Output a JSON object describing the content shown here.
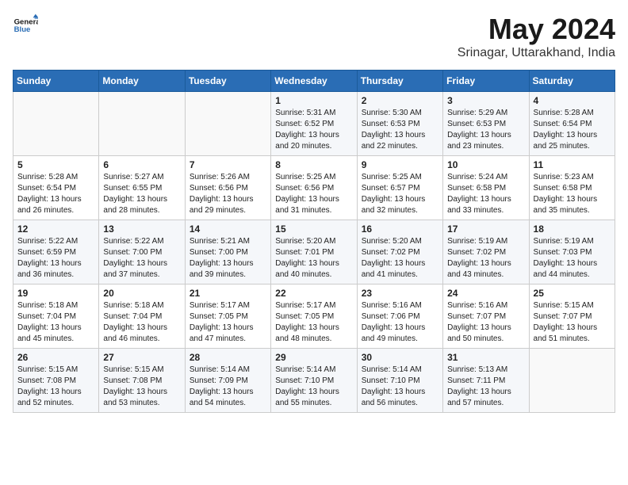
{
  "header": {
    "logo_general": "General",
    "logo_blue": "Blue",
    "month": "May 2024",
    "location": "Srinagar, Uttarakhand, India"
  },
  "weekdays": [
    "Sunday",
    "Monday",
    "Tuesday",
    "Wednesday",
    "Thursday",
    "Friday",
    "Saturday"
  ],
  "weeks": [
    [
      {
        "day": "",
        "info": ""
      },
      {
        "day": "",
        "info": ""
      },
      {
        "day": "",
        "info": ""
      },
      {
        "day": "1",
        "info": "Sunrise: 5:31 AM\nSunset: 6:52 PM\nDaylight: 13 hours\nand 20 minutes."
      },
      {
        "day": "2",
        "info": "Sunrise: 5:30 AM\nSunset: 6:53 PM\nDaylight: 13 hours\nand 22 minutes."
      },
      {
        "day": "3",
        "info": "Sunrise: 5:29 AM\nSunset: 6:53 PM\nDaylight: 13 hours\nand 23 minutes."
      },
      {
        "day": "4",
        "info": "Sunrise: 5:28 AM\nSunset: 6:54 PM\nDaylight: 13 hours\nand 25 minutes."
      }
    ],
    [
      {
        "day": "5",
        "info": "Sunrise: 5:28 AM\nSunset: 6:54 PM\nDaylight: 13 hours\nand 26 minutes."
      },
      {
        "day": "6",
        "info": "Sunrise: 5:27 AM\nSunset: 6:55 PM\nDaylight: 13 hours\nand 28 minutes."
      },
      {
        "day": "7",
        "info": "Sunrise: 5:26 AM\nSunset: 6:56 PM\nDaylight: 13 hours\nand 29 minutes."
      },
      {
        "day": "8",
        "info": "Sunrise: 5:25 AM\nSunset: 6:56 PM\nDaylight: 13 hours\nand 31 minutes."
      },
      {
        "day": "9",
        "info": "Sunrise: 5:25 AM\nSunset: 6:57 PM\nDaylight: 13 hours\nand 32 minutes."
      },
      {
        "day": "10",
        "info": "Sunrise: 5:24 AM\nSunset: 6:58 PM\nDaylight: 13 hours\nand 33 minutes."
      },
      {
        "day": "11",
        "info": "Sunrise: 5:23 AM\nSunset: 6:58 PM\nDaylight: 13 hours\nand 35 minutes."
      }
    ],
    [
      {
        "day": "12",
        "info": "Sunrise: 5:22 AM\nSunset: 6:59 PM\nDaylight: 13 hours\nand 36 minutes."
      },
      {
        "day": "13",
        "info": "Sunrise: 5:22 AM\nSunset: 7:00 PM\nDaylight: 13 hours\nand 37 minutes."
      },
      {
        "day": "14",
        "info": "Sunrise: 5:21 AM\nSunset: 7:00 PM\nDaylight: 13 hours\nand 39 minutes."
      },
      {
        "day": "15",
        "info": "Sunrise: 5:20 AM\nSunset: 7:01 PM\nDaylight: 13 hours\nand 40 minutes."
      },
      {
        "day": "16",
        "info": "Sunrise: 5:20 AM\nSunset: 7:02 PM\nDaylight: 13 hours\nand 41 minutes."
      },
      {
        "day": "17",
        "info": "Sunrise: 5:19 AM\nSunset: 7:02 PM\nDaylight: 13 hours\nand 43 minutes."
      },
      {
        "day": "18",
        "info": "Sunrise: 5:19 AM\nSunset: 7:03 PM\nDaylight: 13 hours\nand 44 minutes."
      }
    ],
    [
      {
        "day": "19",
        "info": "Sunrise: 5:18 AM\nSunset: 7:04 PM\nDaylight: 13 hours\nand 45 minutes."
      },
      {
        "day": "20",
        "info": "Sunrise: 5:18 AM\nSunset: 7:04 PM\nDaylight: 13 hours\nand 46 minutes."
      },
      {
        "day": "21",
        "info": "Sunrise: 5:17 AM\nSunset: 7:05 PM\nDaylight: 13 hours\nand 47 minutes."
      },
      {
        "day": "22",
        "info": "Sunrise: 5:17 AM\nSunset: 7:05 PM\nDaylight: 13 hours\nand 48 minutes."
      },
      {
        "day": "23",
        "info": "Sunrise: 5:16 AM\nSunset: 7:06 PM\nDaylight: 13 hours\nand 49 minutes."
      },
      {
        "day": "24",
        "info": "Sunrise: 5:16 AM\nSunset: 7:07 PM\nDaylight: 13 hours\nand 50 minutes."
      },
      {
        "day": "25",
        "info": "Sunrise: 5:15 AM\nSunset: 7:07 PM\nDaylight: 13 hours\nand 51 minutes."
      }
    ],
    [
      {
        "day": "26",
        "info": "Sunrise: 5:15 AM\nSunset: 7:08 PM\nDaylight: 13 hours\nand 52 minutes."
      },
      {
        "day": "27",
        "info": "Sunrise: 5:15 AM\nSunset: 7:08 PM\nDaylight: 13 hours\nand 53 minutes."
      },
      {
        "day": "28",
        "info": "Sunrise: 5:14 AM\nSunset: 7:09 PM\nDaylight: 13 hours\nand 54 minutes."
      },
      {
        "day": "29",
        "info": "Sunrise: 5:14 AM\nSunset: 7:10 PM\nDaylight: 13 hours\nand 55 minutes."
      },
      {
        "day": "30",
        "info": "Sunrise: 5:14 AM\nSunset: 7:10 PM\nDaylight: 13 hours\nand 56 minutes."
      },
      {
        "day": "31",
        "info": "Sunrise: 5:13 AM\nSunset: 7:11 PM\nDaylight: 13 hours\nand 57 minutes."
      },
      {
        "day": "",
        "info": ""
      }
    ]
  ]
}
